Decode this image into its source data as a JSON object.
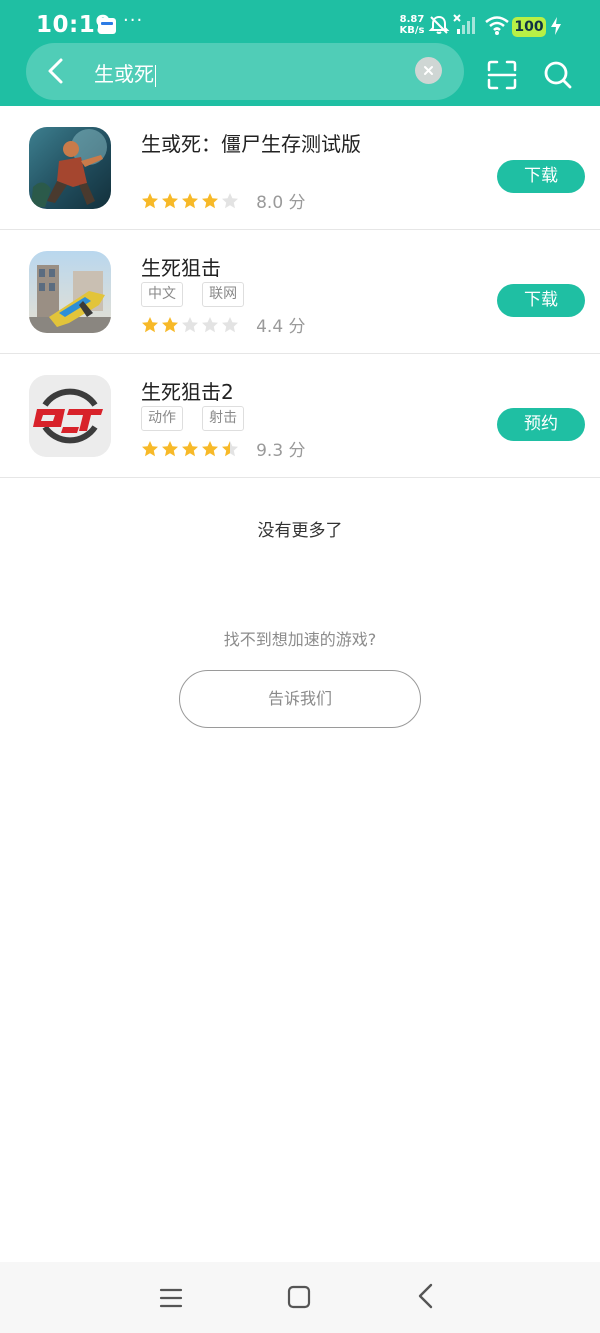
{
  "status_bar": {
    "time": "10:19",
    "more": "···",
    "net_speed_value": "8.87",
    "net_speed_unit": "KB/s",
    "battery": "100"
  },
  "search": {
    "query": "生或死"
  },
  "results": [
    {
      "name": "生或死：僵尸生存测试版",
      "tags": [],
      "rating": 4,
      "score": "8.0 分",
      "action": "下载"
    },
    {
      "name": "生死狙击",
      "tags": [
        "中文",
        "联网"
      ],
      "rating": 2,
      "score": "4.4 分",
      "action": "下载"
    },
    {
      "name": "生死狙击2",
      "tags": [
        "动作",
        "射击"
      ],
      "rating": 4.5,
      "score": "9.3 分",
      "action": "预约"
    }
  ],
  "footer": {
    "end_text": "没有更多了",
    "prompt": "找不到想加速的游戏?",
    "tell_button": "告诉我们"
  },
  "colors": {
    "accent": "#1fbfa3",
    "star": "#f7b928",
    "star_empty": "#e3e3e3"
  }
}
